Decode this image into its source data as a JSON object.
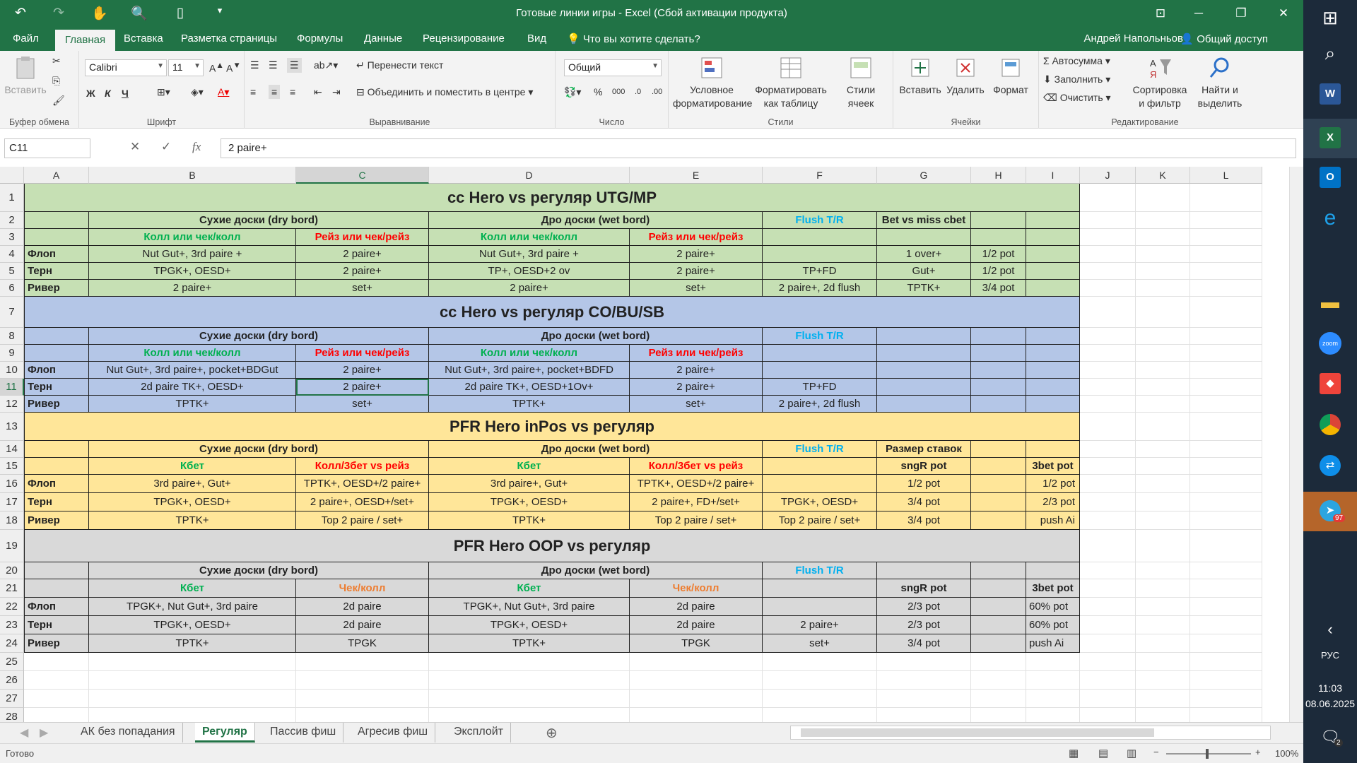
{
  "titlebar": {
    "title": "Готовые линии игры - Excel (Сбой активации продукта)"
  },
  "menu": {
    "tabs": [
      "Файл",
      "Главная",
      "Вставка",
      "Разметка страницы",
      "Формулы",
      "Данные",
      "Рецензирование",
      "Вид"
    ],
    "tell_me": "Что вы хотите сделать?",
    "user": "Андрей Напольньов",
    "share": "Общий доступ"
  },
  "ribbon": {
    "clipboard": {
      "paste": "Вставить",
      "label": "Буфер обмена"
    },
    "font": {
      "name": "Calibri",
      "size": "11",
      "bold": "Ж",
      "italic": "К",
      "underline": "Ч",
      "label": "Шрифт"
    },
    "alignment": {
      "wrap": "Перенести текст",
      "merge": "Объединить и поместить в центре",
      "label": "Выравнивание"
    },
    "number": {
      "format": "Общий",
      "label": "Число"
    },
    "styles": {
      "conditional_1": "Условное",
      "conditional_2": "форматирование",
      "table_1": "Форматировать",
      "table_2": "как таблицу",
      "cell_1": "Стили",
      "cell_2": "ячеек",
      "label": "Стили"
    },
    "cells": {
      "insert": "Вставить",
      "delete": "Удалить",
      "format": "Формат",
      "label": "Ячейки"
    },
    "editing": {
      "autosum": "Автосумма",
      "fill": "Заполнить",
      "clear": "Очистить",
      "sort_1": "Сортировка",
      "sort_2": "и фильтр",
      "find_1": "Найти и",
      "find_2": "выделить",
      "label": "Редактирование"
    }
  },
  "formula_bar": {
    "name_box": "C11",
    "fx": "fx",
    "formula": "2 paire+"
  },
  "columns": [
    "A",
    "B",
    "C",
    "D",
    "E",
    "F",
    "G",
    "H",
    "I",
    "J",
    "K",
    "L"
  ],
  "selected_column": "C",
  "selected_row": "11",
  "colors": {
    "green_bg": "#c6e0b4",
    "blue_bg": "#b4c6e7",
    "yellow_bg": "#ffe699",
    "grey_bg": "#d9d9d9",
    "green_text": "#00b050",
    "red_text": "#ff0000",
    "blue_text": "#00b0f0",
    "orange_text": "#ed7d31"
  },
  "rows": [
    {
      "n": "1",
      "cells": [
        {
          "c": "A",
          "span": 9,
          "t": "cc Hero vs регуляр UTG/MP",
          "s": "title"
        }
      ]
    },
    {
      "n": "2",
      "cells": [
        {
          "c": "A",
          "t": ""
        },
        {
          "c": "B",
          "span": 2,
          "t": "Сухие доски (dry bord)",
          "s": "b"
        },
        {
          "c": "D",
          "span": 2,
          "t": "Дро доски (wet bord)",
          "s": "b"
        },
        {
          "c": "F",
          "t": "Flush T/R",
          "s": "b",
          "col": "blue"
        },
        {
          "c": "G",
          "t": "Bet vs miss cbet",
          "s": "b"
        },
        {
          "c": "H",
          "t": ""
        },
        {
          "c": "I",
          "t": ""
        }
      ]
    },
    {
      "n": "3",
      "cells": [
        {
          "c": "A",
          "t": ""
        },
        {
          "c": "B",
          "t": "Колл или чек/колл",
          "s": "b",
          "col": "green"
        },
        {
          "c": "C",
          "t": "Рейз или чек/рейз",
          "s": "b",
          "col": "red"
        },
        {
          "c": "D",
          "t": "Колл или чек/колл",
          "s": "b",
          "col": "green"
        },
        {
          "c": "E",
          "t": "Рейз или чек/рейз",
          "s": "b",
          "col": "red"
        },
        {
          "c": "F",
          "t": ""
        },
        {
          "c": "G",
          "t": ""
        },
        {
          "c": "H",
          "t": ""
        },
        {
          "c": "I",
          "t": ""
        }
      ]
    },
    {
      "n": "4",
      "cells": [
        {
          "c": "A",
          "t": "Флоп",
          "s": "b",
          "a": "l"
        },
        {
          "c": "B",
          "t": "Nut Gut+, 3rd paire +"
        },
        {
          "c": "C",
          "t": "2 paire+"
        },
        {
          "c": "D",
          "t": "Nut Gut+, 3rd paire +"
        },
        {
          "c": "E",
          "t": "2 paire+"
        },
        {
          "c": "F",
          "t": ""
        },
        {
          "c": "G",
          "t": "1 over+"
        },
        {
          "c": "H",
          "t": "1/2 pot"
        },
        {
          "c": "I",
          "t": ""
        }
      ]
    },
    {
      "n": "5",
      "cells": [
        {
          "c": "A",
          "t": "Терн",
          "s": "b",
          "a": "l"
        },
        {
          "c": "B",
          "t": "TPGK+, OESD+"
        },
        {
          "c": "C",
          "t": "2 paire+"
        },
        {
          "c": "D",
          "t": "TP+, OESD+2 ov"
        },
        {
          "c": "E",
          "t": "2 paire+"
        },
        {
          "c": "F",
          "t": "TP+FD"
        },
        {
          "c": "G",
          "t": "Gut+"
        },
        {
          "c": "H",
          "t": "1/2 pot"
        },
        {
          "c": "I",
          "t": ""
        }
      ]
    },
    {
      "n": "6",
      "cells": [
        {
          "c": "A",
          "t": "Ривер",
          "s": "b",
          "a": "l"
        },
        {
          "c": "B",
          "t": "2 paire+"
        },
        {
          "c": "C",
          "t": "set+"
        },
        {
          "c": "D",
          "t": "2 paire+"
        },
        {
          "c": "E",
          "t": "set+"
        },
        {
          "c": "F",
          "t": "2 paire+, 2d flush"
        },
        {
          "c": "G",
          "t": "TPTK+"
        },
        {
          "c": "H",
          "t": "3/4 pot"
        },
        {
          "c": "I",
          "t": ""
        }
      ]
    },
    {
      "n": "7",
      "cells": [
        {
          "c": "A",
          "span": 9,
          "t": "cc Hero vs регуляр CO/BU/SB",
          "s": "title"
        }
      ]
    },
    {
      "n": "8",
      "cells": [
        {
          "c": "A",
          "t": ""
        },
        {
          "c": "B",
          "span": 2,
          "t": "Сухие доски (dry bord)",
          "s": "b"
        },
        {
          "c": "D",
          "span": 2,
          "t": "Дро доски (wet bord)",
          "s": "b"
        },
        {
          "c": "F",
          "t": "Flush T/R",
          "s": "b",
          "col": "blue"
        },
        {
          "c": "G",
          "t": ""
        },
        {
          "c": "H",
          "t": ""
        },
        {
          "c": "I",
          "t": ""
        }
      ]
    },
    {
      "n": "9",
      "cells": [
        {
          "c": "A",
          "t": ""
        },
        {
          "c": "B",
          "t": "Колл или чек/колл",
          "s": "b",
          "col": "green"
        },
        {
          "c": "C",
          "t": "Рейз или чек/рейз",
          "s": "b",
          "col": "red"
        },
        {
          "c": "D",
          "t": "Колл или чек/колл",
          "s": "b",
          "col": "green"
        },
        {
          "c": "E",
          "t": "Рейз или чек/рейз",
          "s": "b",
          "col": "red"
        },
        {
          "c": "F",
          "t": ""
        },
        {
          "c": "G",
          "t": ""
        },
        {
          "c": "H",
          "t": ""
        },
        {
          "c": "I",
          "t": ""
        }
      ]
    },
    {
      "n": "10",
      "cells": [
        {
          "c": "A",
          "t": "Флоп",
          "s": "b",
          "a": "l"
        },
        {
          "c": "B",
          "t": "Nut Gut+, 3rd paire+, pocket+BDGut"
        },
        {
          "c": "C",
          "t": "2 paire+"
        },
        {
          "c": "D",
          "t": "Nut Gut+, 3rd paire+, pocket+BDFD"
        },
        {
          "c": "E",
          "t": "2 paire+"
        },
        {
          "c": "F",
          "t": ""
        },
        {
          "c": "G",
          "t": ""
        },
        {
          "c": "H",
          "t": ""
        },
        {
          "c": "I",
          "t": ""
        }
      ]
    },
    {
      "n": "11",
      "cells": [
        {
          "c": "A",
          "t": "Терн",
          "s": "b",
          "a": "l"
        },
        {
          "c": "B",
          "t": "2d paire TK+, OESD+"
        },
        {
          "c": "C",
          "t": "2 paire+",
          "sel": true
        },
        {
          "c": "D",
          "t": "2d paire TK+, OESD+1Ov+"
        },
        {
          "c": "E",
          "t": "2 paire+"
        },
        {
          "c": "F",
          "t": "TP+FD"
        },
        {
          "c": "G",
          "t": ""
        },
        {
          "c": "H",
          "t": ""
        },
        {
          "c": "I",
          "t": ""
        }
      ]
    },
    {
      "n": "12",
      "cells": [
        {
          "c": "A",
          "t": "Ривер",
          "s": "b",
          "a": "l"
        },
        {
          "c": "B",
          "t": "TPTK+"
        },
        {
          "c": "C",
          "t": "set+"
        },
        {
          "c": "D",
          "t": "TPTK+"
        },
        {
          "c": "E",
          "t": "set+"
        },
        {
          "c": "F",
          "t": "2 paire+, 2d flush"
        },
        {
          "c": "G",
          "t": ""
        },
        {
          "c": "H",
          "t": ""
        },
        {
          "c": "I",
          "t": ""
        }
      ]
    },
    {
      "n": "13",
      "cells": [
        {
          "c": "A",
          "span": 9,
          "t": "PFR Hero inPos vs регуляр",
          "s": "title"
        }
      ]
    },
    {
      "n": "14",
      "cells": [
        {
          "c": "A",
          "t": ""
        },
        {
          "c": "B",
          "span": 2,
          "t": "Сухие доски (dry bord)",
          "s": "b"
        },
        {
          "c": "D",
          "span": 2,
          "t": "Дро доски (wet bord)",
          "s": "b"
        },
        {
          "c": "F",
          "t": "Flush T/R",
          "s": "b",
          "col": "blue"
        },
        {
          "c": "G",
          "t": "Размер ставок",
          "s": "b"
        },
        {
          "c": "H",
          "t": ""
        },
        {
          "c": "I",
          "t": ""
        }
      ]
    },
    {
      "n": "15",
      "cells": [
        {
          "c": "A",
          "t": ""
        },
        {
          "c": "B",
          "t": "Кбет",
          "s": "b",
          "col": "green"
        },
        {
          "c": "C",
          "t": "Колл/3бет vs рейз",
          "s": "b",
          "col": "red"
        },
        {
          "c": "D",
          "t": "Кбет",
          "s": "b",
          "col": "green"
        },
        {
          "c": "E",
          "t": "Колл/3бет vs рейз",
          "s": "b",
          "col": "red"
        },
        {
          "c": "F",
          "t": ""
        },
        {
          "c": "G",
          "t": "sngR pot",
          "s": "b"
        },
        {
          "c": "H",
          "t": ""
        },
        {
          "c": "I",
          "t": "3bet pot",
          "s": "b"
        }
      ]
    },
    {
      "n": "16",
      "cells": [
        {
          "c": "A",
          "t": "Флоп",
          "s": "b",
          "a": "l"
        },
        {
          "c": "B",
          "t": "3rd paire+, Gut+"
        },
        {
          "c": "C",
          "t": "TPTK+, OESD+/2 paire+"
        },
        {
          "c": "D",
          "t": "3rd paire+, Gut+"
        },
        {
          "c": "E",
          "t": "TPTK+, OESD+/2 paire+"
        },
        {
          "c": "F",
          "t": ""
        },
        {
          "c": "G",
          "t": "1/2 pot"
        },
        {
          "c": "H",
          "t": ""
        },
        {
          "c": "I",
          "t": "1/2 pot",
          "a": "r"
        }
      ]
    },
    {
      "n": "17",
      "cells": [
        {
          "c": "A",
          "t": "Терн",
          "s": "b",
          "a": "l"
        },
        {
          "c": "B",
          "t": "TPGK+, OESD+"
        },
        {
          "c": "C",
          "t": "2 paire+, OESD+/set+"
        },
        {
          "c": "D",
          "t": "TPGK+, OESD+"
        },
        {
          "c": "E",
          "t": "2 paire+, FD+/set+"
        },
        {
          "c": "F",
          "t": "TPGK+, OESD+"
        },
        {
          "c": "G",
          "t": "3/4 pot"
        },
        {
          "c": "H",
          "t": ""
        },
        {
          "c": "I",
          "t": "2/3 pot",
          "a": "r"
        }
      ]
    },
    {
      "n": "18",
      "cells": [
        {
          "c": "A",
          "t": "Ривер",
          "s": "b",
          "a": "l"
        },
        {
          "c": "B",
          "t": "TPTK+"
        },
        {
          "c": "C",
          "t": "Top 2 paire / set+"
        },
        {
          "c": "D",
          "t": "TPTK+"
        },
        {
          "c": "E",
          "t": "Top 2 paire / set+"
        },
        {
          "c": "F",
          "t": "Top 2 paire / set+"
        },
        {
          "c": "G",
          "t": "3/4 pot"
        },
        {
          "c": "H",
          "t": ""
        },
        {
          "c": "I",
          "t": "push Ai",
          "a": "r"
        }
      ]
    },
    {
      "n": "19",
      "cells": [
        {
          "c": "A",
          "span": 9,
          "t": "PFR Hero OOP vs регуляр",
          "s": "title"
        }
      ]
    },
    {
      "n": "20",
      "cells": [
        {
          "c": "A",
          "t": ""
        },
        {
          "c": "B",
          "span": 2,
          "t": "Сухие доски (dry bord)",
          "s": "b"
        },
        {
          "c": "D",
          "span": 2,
          "t": "Дро доски (wet bord)",
          "s": "b"
        },
        {
          "c": "F",
          "t": "Flush T/R",
          "s": "b",
          "col": "blue"
        },
        {
          "c": "G",
          "t": ""
        },
        {
          "c": "H",
          "t": ""
        },
        {
          "c": "I",
          "t": ""
        }
      ]
    },
    {
      "n": "21",
      "cells": [
        {
          "c": "A",
          "t": ""
        },
        {
          "c": "B",
          "t": "Кбет",
          "s": "b",
          "col": "green"
        },
        {
          "c": "C",
          "t": "Чек/колл",
          "s": "b",
          "col": "orange"
        },
        {
          "c": "D",
          "t": "Кбет",
          "s": "b",
          "col": "green"
        },
        {
          "c": "E",
          "t": "Чек/колл",
          "s": "b",
          "col": "orange"
        },
        {
          "c": "F",
          "t": ""
        },
        {
          "c": "G",
          "t": "sngR pot",
          "s": "b"
        },
        {
          "c": "H",
          "t": ""
        },
        {
          "c": "I",
          "t": "3bet pot",
          "s": "b"
        }
      ]
    },
    {
      "n": "22",
      "cells": [
        {
          "c": "A",
          "t": "Флоп",
          "s": "b",
          "a": "l"
        },
        {
          "c": "B",
          "t": "TPGK+, Nut Gut+, 3rd paire"
        },
        {
          "c": "C",
          "t": "2d paire"
        },
        {
          "c": "D",
          "t": "TPGK+, Nut Gut+, 3rd paire"
        },
        {
          "c": "E",
          "t": "2d paire"
        },
        {
          "c": "F",
          "t": ""
        },
        {
          "c": "G",
          "t": "2/3 pot"
        },
        {
          "c": "H",
          "t": ""
        },
        {
          "c": "I",
          "t": "60% pot",
          "a": "l"
        }
      ]
    },
    {
      "n": "23",
      "cells": [
        {
          "c": "A",
          "t": "Терн",
          "s": "b",
          "a": "l"
        },
        {
          "c": "B",
          "t": "TPGK+, OESD+"
        },
        {
          "c": "C",
          "t": "2d paire"
        },
        {
          "c": "D",
          "t": "TPGK+, OESD+"
        },
        {
          "c": "E",
          "t": "2d paire"
        },
        {
          "c": "F",
          "t": "2 paire+"
        },
        {
          "c": "G",
          "t": "2/3 pot"
        },
        {
          "c": "H",
          "t": ""
        },
        {
          "c": "I",
          "t": "60% pot",
          "a": "l"
        }
      ]
    },
    {
      "n": "24",
      "cells": [
        {
          "c": "A",
          "t": "Ривер",
          "s": "b",
          "a": "l"
        },
        {
          "c": "B",
          "t": "TPTK+"
        },
        {
          "c": "C",
          "t": "TPGK"
        },
        {
          "c": "D",
          "t": "TPTK+"
        },
        {
          "c": "E",
          "t": "TPGK"
        },
        {
          "c": "F",
          "t": "set+"
        },
        {
          "c": "G",
          "t": "3/4 pot"
        },
        {
          "c": "H",
          "t": ""
        },
        {
          "c": "I",
          "t": "push Ai",
          "a": "l"
        }
      ]
    }
  ],
  "empty_rows": [
    "25",
    "26",
    "27",
    "28"
  ],
  "sheets": [
    "АК без попадания",
    "Регуляр",
    "Пассив фиш",
    "Агресив фиш",
    "Эксплойт"
  ],
  "active_sheet": "Регуляр",
  "status": {
    "ready": "Готово",
    "zoom": "100%"
  },
  "taskbar": {
    "lang": "РУС",
    "time": "11:03",
    "date": "08.06.2025",
    "telegram_badge": "97",
    "notif_badge": "2"
  }
}
